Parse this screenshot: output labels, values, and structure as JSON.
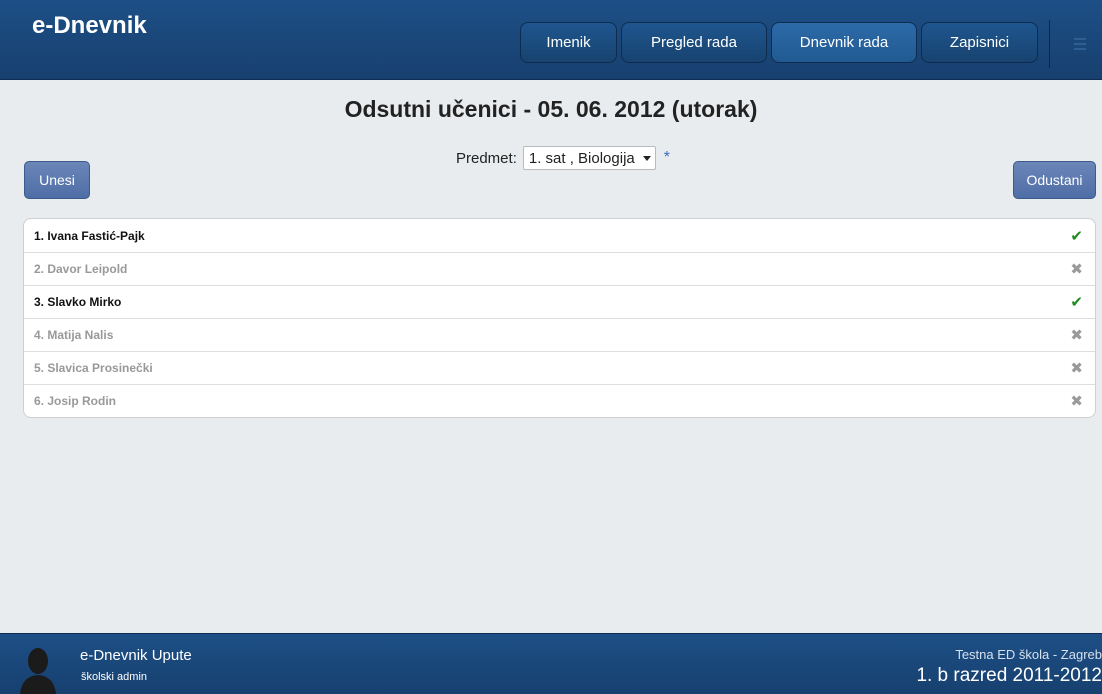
{
  "app": {
    "title": "e-Dnevnik"
  },
  "nav": [
    {
      "label": "Imenik",
      "active": false
    },
    {
      "label": "Pregled rada",
      "active": false
    },
    {
      "label": "Dnevnik rada",
      "active": true
    },
    {
      "label": "Zapisnici",
      "active": false
    }
  ],
  "page": {
    "title": "Odsutni učenici - 05. 06. 2012 (utorak)"
  },
  "buttons": {
    "enter": "Unesi",
    "cancel": "Odustani"
  },
  "subject": {
    "label": "Predmet:",
    "value": "1. sat , Biologija",
    "required": "*"
  },
  "students": [
    {
      "name": "1. Ivana Fastić-Pajk",
      "present": true
    },
    {
      "name": "2. Davor Leipold",
      "present": false
    },
    {
      "name": "3. Slavko Mirko",
      "present": true
    },
    {
      "name": "4. Matija Nalis",
      "present": false
    },
    {
      "name": "5. Slavica Prosinečki",
      "present": false
    },
    {
      "name": "6. Josip Rodin",
      "present": false
    }
  ],
  "marks": {
    "present": "✔",
    "absent": "✖"
  },
  "footer": {
    "title": "e-Dnevnik Upute",
    "role": "školski admin",
    "school": "Testna ED škola - Zagreb",
    "class": "1. b razred 2011-2012"
  },
  "colors": {
    "header": "#1d4f86",
    "button": "#5a78ae",
    "check": "#1e8c1e",
    "cross": "#9a9a9a"
  }
}
